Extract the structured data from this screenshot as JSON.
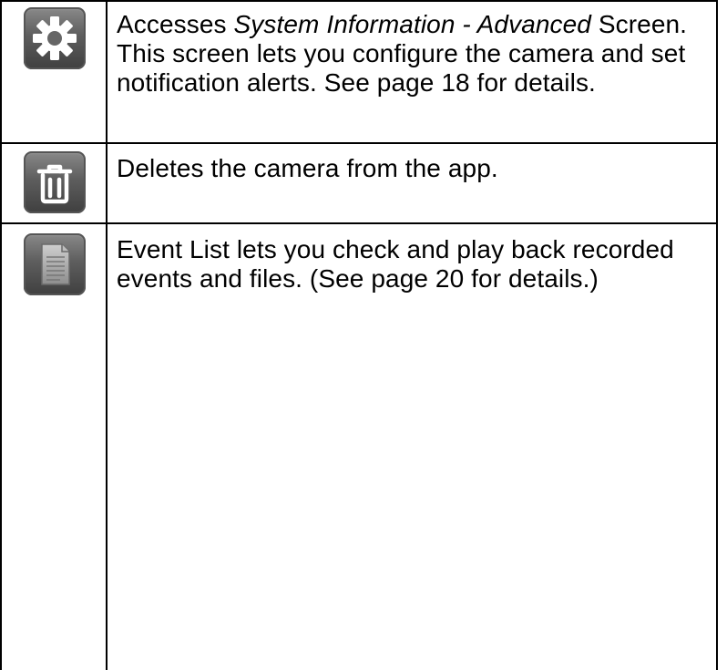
{
  "rows": [
    {
      "icon": "gear-icon",
      "text_before": "Accesses ",
      "text_italic": "System Information - Advanced",
      "text_after": " Screen. This screen lets you configure the camera and set notification alerts. See page 18 for details."
    },
    {
      "icon": "trash-icon",
      "text": "Deletes the camera from the app."
    },
    {
      "icon": "document-list-icon",
      "text": "Event List lets you check and play back recorded events and files. (See page 20 for details.)"
    }
  ],
  "colors": {
    "border": "#000000",
    "icon_bg": "#5e5e5e",
    "icon_fg": "#ffffff"
  }
}
